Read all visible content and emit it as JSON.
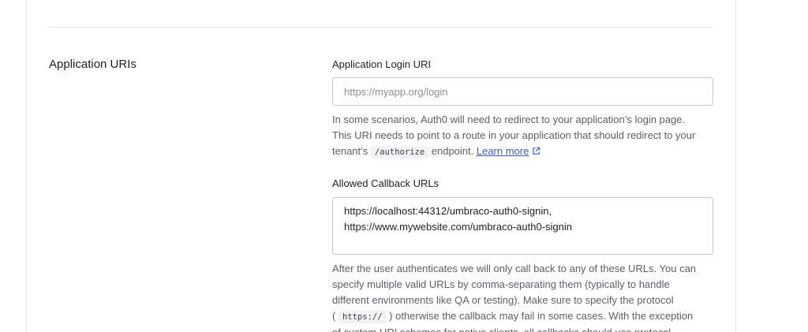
{
  "section": {
    "title": "Application URIs"
  },
  "login_uri": {
    "label": "Application Login URI",
    "placeholder": "https://myapp.org/login",
    "value": "",
    "help_line1": "In some scenarios, Auth0 will need to redirect to your application’s login page.",
    "help_line2": "This URI needs to point to a route in your application that should redirect to your",
    "help_prefix": "tenant’s ",
    "help_code": "/authorize",
    "help_suffix": " endpoint. ",
    "learn_more": "Learn more",
    "link_icon": "external-link-icon"
  },
  "callback_urls": {
    "label": "Allowed Callback URLs",
    "value": "https://localhost:44312/umbraco-auth0-signin,\nhttps://www.mywebsite.com/umbraco-auth0-signin",
    "help_line1": "After the user authenticates we will only call back to any of these URLs. You can",
    "help_line2": "specify multiple valid URLs by comma-separating them (typically to handle",
    "help_line3": "different environments like QA or testing). Make sure to specify the protocol",
    "help_line4_open": "( ",
    "help_code": "https://",
    "help_line4_rest": " ) otherwise the callback may fail in some cases. With the exception",
    "help_line5": "of custom URI schemes for native clients, all callbacks should use protocol"
  },
  "colors": {
    "link": "#3b5bdb",
    "border": "#c9cace",
    "help_text": "#5c606b"
  }
}
